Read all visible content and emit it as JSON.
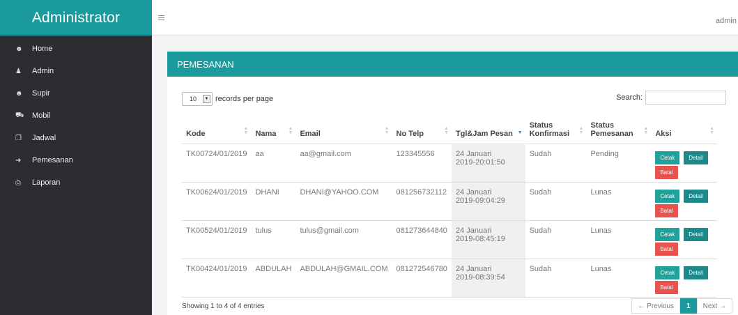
{
  "sidebar": {
    "brand": "Administrator",
    "items": [
      {
        "label": "Home",
        "icon": "dashboard-icon"
      },
      {
        "label": "Admin",
        "icon": "user-icon"
      },
      {
        "label": "Supir",
        "icon": "dashboard-icon"
      },
      {
        "label": "Mobil",
        "icon": "car-icon"
      },
      {
        "label": "Jadwal",
        "icon": "copy-icon"
      },
      {
        "label": "Pemesanan",
        "icon": "sign-in-icon"
      },
      {
        "label": "Laporan",
        "icon": "print-icon"
      }
    ]
  },
  "topbar": {
    "user": "admin"
  },
  "panel": {
    "title": "PEMESANAN"
  },
  "table_controls": {
    "length_value": "10",
    "length_label": "records per page",
    "search_label": "Search:",
    "search_value": ""
  },
  "table": {
    "headers": [
      "Kode",
      "Nama",
      "Email",
      "No Telp",
      "Tgl&Jam Pesan",
      "Status Konfirmasi",
      "Status Pemesanan",
      "Aksi"
    ],
    "sorted_column": "Tgl&Jam Pesan",
    "rows": [
      {
        "kode": "TK00724/01/2019",
        "nama": "aa",
        "email": "aa@gmail.com",
        "telp": "123345556",
        "tgl_line1": "24 Januari",
        "tgl_line2": "2019-20:01:50",
        "konfirmasi": "Sudah",
        "pemesanan": "Pending"
      },
      {
        "kode": "TK00624/01/2019",
        "nama": "DHANI",
        "email": "DHANI@YAHOO.COM",
        "telp": "081256732112",
        "tgl_line1": "24 Januari",
        "tgl_line2": "2019-09:04:29",
        "konfirmasi": "Sudah",
        "pemesanan": "Lunas"
      },
      {
        "kode": "TK00524/01/2019",
        "nama": "tulus",
        "email": "tulus@gmail.com",
        "telp": "081273644840",
        "tgl_line1": "24 Januari",
        "tgl_line2": "2019-08:45:19",
        "konfirmasi": "Sudah",
        "pemesanan": "Lunas"
      },
      {
        "kode": "TK00424/01/2019",
        "nama": "ABDULAH",
        "email": "ABDULAH@GMAIL.COM",
        "telp": "081272546780",
        "tgl_line1": "24 Januari",
        "tgl_line2": "2019-08:39:54",
        "konfirmasi": "Sudah",
        "pemesanan": "Lunas"
      }
    ],
    "actions": {
      "cetak": "Cetak",
      "detail": "Detail",
      "batal": "Batal"
    }
  },
  "footer": {
    "info": "Showing 1 to 4 of 4 entries",
    "prev": "← Previous",
    "page": "1",
    "next": "Next →"
  },
  "colors": {
    "accent": "#1a9a9c",
    "sidebar_bg": "#2b2d30",
    "danger": "#e9534f"
  }
}
